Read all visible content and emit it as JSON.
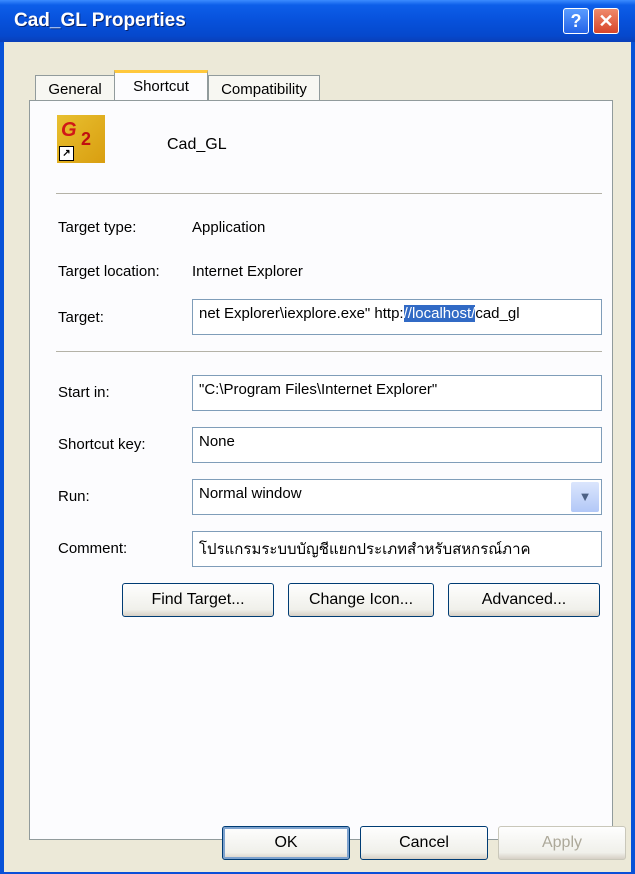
{
  "window": {
    "title": "Cad_GL Properties",
    "help_glyph": "?",
    "close_glyph": "✕"
  },
  "tabs": [
    {
      "label": "General",
      "active": false
    },
    {
      "label": "Shortcut",
      "active": true
    },
    {
      "label": "Compatibility",
      "active": false
    }
  ],
  "shortcut": {
    "name": "Cad_GL",
    "icon": "cad-gl-app-icon",
    "target_type_label": "Target type:",
    "target_type_value": "Application",
    "target_location_label": "Target location:",
    "target_location_value": "Internet Explorer",
    "target_label": "Target:",
    "target_before": "net Explorer\\iexplore.exe\" http:",
    "target_selected": "//localhost/",
    "target_after": "cad_gl",
    "start_in_label": "Start in:",
    "start_in_value": "\"C:\\Program Files\\Internet Explorer\"",
    "shortcut_key_label": "Shortcut key:",
    "shortcut_key_value": "None",
    "run_label": "Run:",
    "run_value": "Normal window",
    "comment_label": "Comment:",
    "comment_value": "โปรแกรมระบบบัญชีแยกประเภทสำหรับสหกรณ์ภาค"
  },
  "buttons": {
    "find_target": "Find Target...",
    "change_icon": "Change Icon...",
    "advanced": "Advanced...",
    "ok": "OK",
    "cancel": "Cancel",
    "apply": "Apply"
  },
  "colors": {
    "titlebar": "#0751db",
    "dialog_bg": "#ece9d8",
    "selection": "#316ac5"
  }
}
